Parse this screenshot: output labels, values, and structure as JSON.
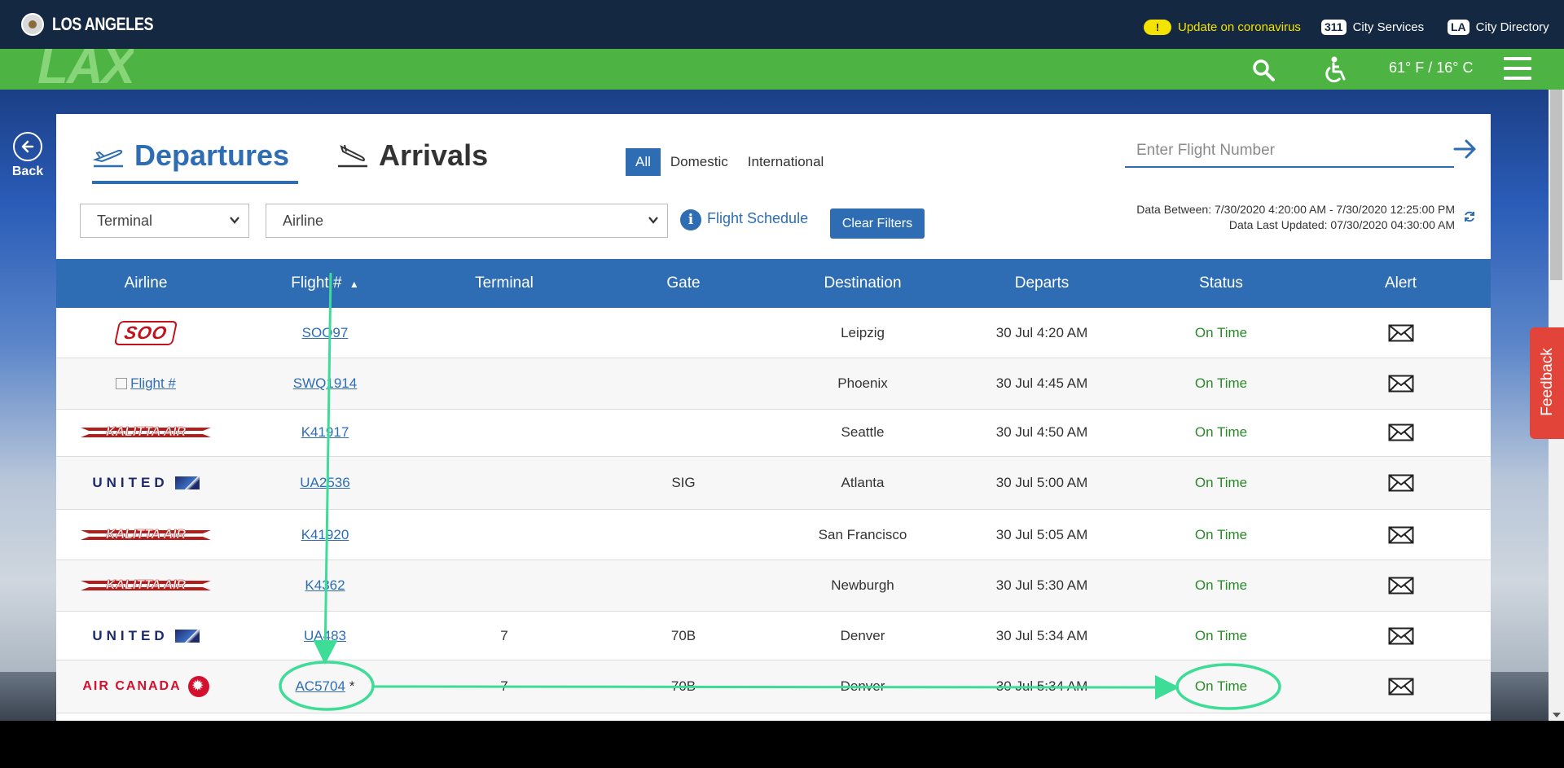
{
  "topbar": {
    "city_name": "LOS ANGELES",
    "covid_badge": "!",
    "covid_text": "Update on coronavirus",
    "services_badge": "311",
    "services_label": "City Services",
    "directory_badge": "LA",
    "directory_label": "City Directory"
  },
  "greenbar": {
    "logo_text": "LAX",
    "temperature": "61° F / 16° C",
    "icons": [
      "search-icon",
      "accessibility-icon",
      "menu-icon"
    ]
  },
  "back": {
    "label": "Back"
  },
  "tabs": {
    "departures": "Departures",
    "arrivals": "Arrivals"
  },
  "filters": {
    "all": "All",
    "domestic": "Domestic",
    "international": "International",
    "flight_placeholder": "Enter Flight Number",
    "terminal_select": "Terminal",
    "airline_select": "Airline",
    "schedule_link": "Flight Schedule",
    "clear_button": "Clear Filters",
    "info_icon": "i",
    "data_between": "Data Between: 7/30/2020 4:20:00 AM - 7/30/2020 12:25:00 PM",
    "data_updated": "Data Last Updated: 07/30/2020 04:30:00 AM"
  },
  "table": {
    "headers": [
      "Airline",
      "Flight #",
      "Terminal",
      "Gate",
      "Destination",
      "Departs",
      "Status",
      "Alert"
    ],
    "sort_indicator": "▲",
    "rows": [
      {
        "airline": "SOO",
        "flight": "SOO97",
        "terminal": "",
        "gate": "",
        "destination": "Leipzig",
        "departs": "30 Jul 4:20 AM",
        "status": "On Time"
      },
      {
        "airline": "Flight #",
        "flight": "SWQ1914",
        "terminal": "",
        "gate": "",
        "destination": "Phoenix",
        "departs": "30 Jul 4:45 AM",
        "status": "On Time"
      },
      {
        "airline": "KALITTA AIR",
        "flight": "K41917",
        "terminal": "",
        "gate": "",
        "destination": "Seattle",
        "departs": "30 Jul 4:50 AM",
        "status": "On Time"
      },
      {
        "airline": "UNITED",
        "flight": "UA2536",
        "terminal": "",
        "gate": "SIG",
        "destination": "Atlanta",
        "departs": "30 Jul 5:00 AM",
        "status": "On Time"
      },
      {
        "airline": "KALITTA AIR",
        "flight": "K41920",
        "terminal": "",
        "gate": "",
        "destination": "San Francisco",
        "departs": "30 Jul 5:05 AM",
        "status": "On Time"
      },
      {
        "airline": "KALITTA AIR",
        "flight": "K4362",
        "terminal": "",
        "gate": "",
        "destination": "Newburgh",
        "departs": "30 Jul 5:30 AM",
        "status": "On Time"
      },
      {
        "airline": "UNITED",
        "flight": "UA483",
        "terminal": "7",
        "gate": "70B",
        "destination": "Denver",
        "departs": "30 Jul 5:34 AM",
        "status": "On Time"
      },
      {
        "airline": "AIR CANADA",
        "flight": "AC5704",
        "flight_suffix": "*",
        "terminal": "7",
        "gate": "70B",
        "destination": "Denver",
        "departs": "30 Jul 5:34 AM",
        "status": "On Time"
      }
    ]
  },
  "feedback": {
    "label": "Feedback"
  },
  "colors": {
    "topbar": "#142842",
    "greenbar": "#4db443",
    "accent_blue": "#2e6db4",
    "status_green": "#2a8a2a",
    "annotation": "#3ddc97",
    "feedback": "#e2443a"
  }
}
